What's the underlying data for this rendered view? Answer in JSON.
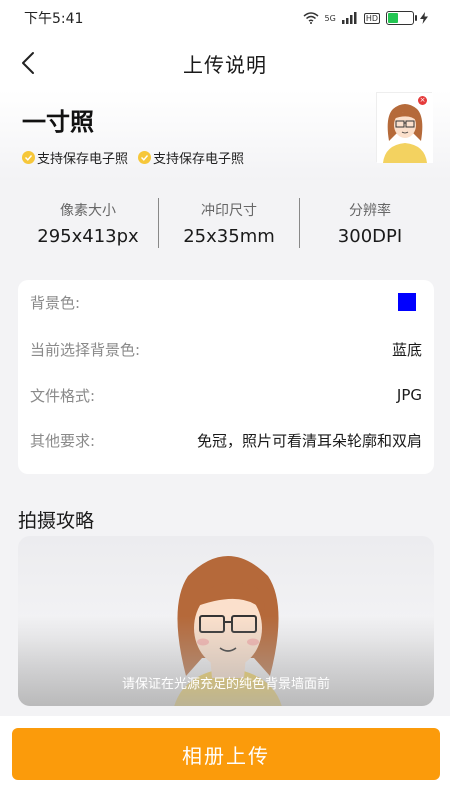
{
  "status_bar": {
    "time": "下午5:41",
    "network": "5G",
    "hd": "HD",
    "battery_level": 0.4
  },
  "navbar": {
    "title": "上传说明",
    "back_icon": "chevron-left-icon"
  },
  "photo": {
    "name": "一寸照",
    "badges": [
      "支持保存电子照",
      "支持保存电子照"
    ],
    "close_mark": "×"
  },
  "specs": [
    {
      "label": "像素大小",
      "value": "295x413px"
    },
    {
      "label": "冲印尺寸",
      "value": "25x35mm"
    },
    {
      "label": "分辨率",
      "value": "300DPI"
    }
  ],
  "info": {
    "bg_color_label": "背景色:",
    "bg_color": "#0000ff",
    "current_bg_label": "当前选择背景色:",
    "current_bg_value": "蓝底",
    "format_label": "文件格式:",
    "format_value": "JPG",
    "other_label": "其他要求:",
    "other_value": "免冠，照片可看清耳朵轮廓和双肩"
  },
  "guide": {
    "title": "拍摄攻略",
    "caption": "请保证在光源充足的纯色背景墙面前"
  },
  "bottom": {
    "upload_label": "相册上传"
  },
  "colors": {
    "accent": "#fb9b0b",
    "badge_check": "#f6c73a"
  }
}
